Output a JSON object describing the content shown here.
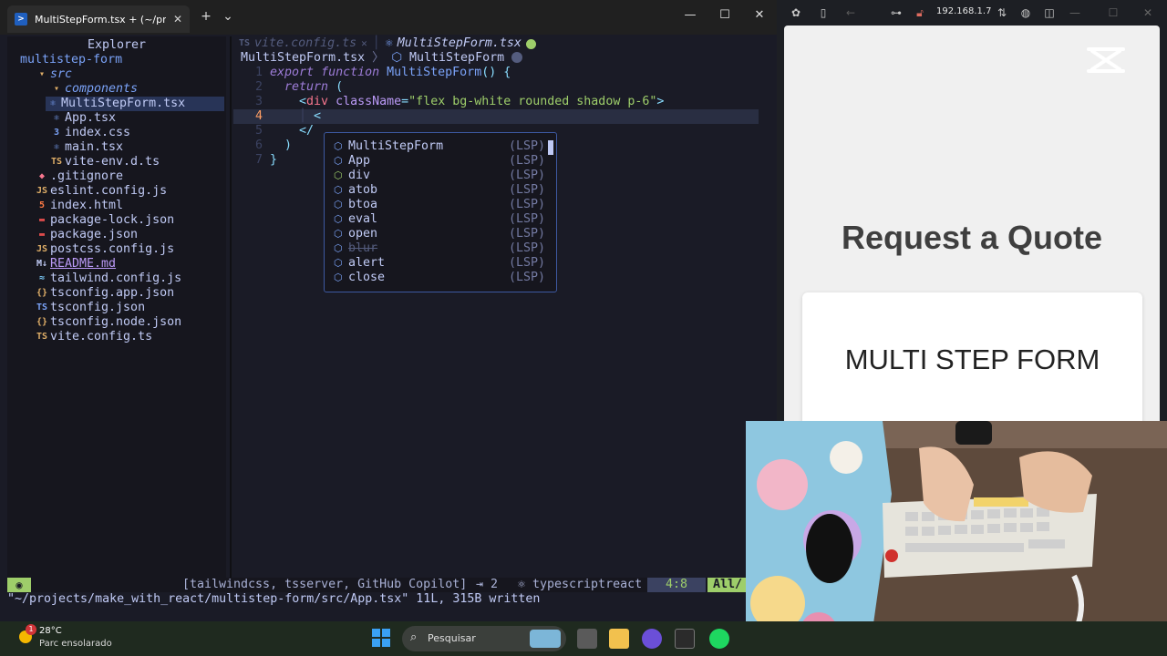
{
  "terminal": {
    "tab_title": "MultiStepForm.tsx + (~/proje",
    "tab_close": "✕",
    "new_tab": "+",
    "dropdown": "⌄",
    "minimize": "—",
    "maximize": "☐",
    "close": "✕"
  },
  "explorer": {
    "title": "Explorer",
    "root": "multistep-form",
    "items": [
      {
        "label": "src",
        "indent": 1,
        "icon": "folder-open-icon",
        "glyph": "▾",
        "color": "#7aa2f7"
      },
      {
        "label": "components",
        "indent": 2,
        "icon": "folder-open-icon",
        "glyph": "▾",
        "color": "#7aa2f7"
      },
      {
        "label": "MultiStepForm.tsx",
        "indent": 3,
        "icon": "react-icon",
        "glyph": "⚛",
        "color": "#c0caf5"
      },
      {
        "label": "App.tsx",
        "indent": 2,
        "icon": "react-icon",
        "glyph": "⚛",
        "color": "#c0caf5"
      },
      {
        "label": "index.css",
        "indent": 2,
        "icon": "css-icon",
        "glyph": "3",
        "color": "#c0caf5"
      },
      {
        "label": "main.tsx",
        "indent": 2,
        "icon": "react-icon",
        "glyph": "⚛",
        "color": "#c0caf5"
      },
      {
        "label": "vite-env.d.ts",
        "indent": 2,
        "icon": "typescript-icon",
        "glyph": "TS",
        "color": "#c0caf5"
      },
      {
        "label": ".gitignore",
        "indent": 1,
        "icon": "git-icon",
        "glyph": "◆",
        "color": "#c0caf5"
      },
      {
        "label": "eslint.config.js",
        "indent": 1,
        "icon": "javascript-icon",
        "glyph": "JS",
        "color": "#c0caf5"
      },
      {
        "label": "index.html",
        "indent": 1,
        "icon": "html-icon",
        "glyph": "5",
        "color": "#c0caf5"
      },
      {
        "label": "package-lock.json",
        "indent": 1,
        "icon": "npm-icon",
        "glyph": "▬",
        "color": "#c0caf5"
      },
      {
        "label": "package.json",
        "indent": 1,
        "icon": "npm-icon",
        "glyph": "▬",
        "color": "#c0caf5"
      },
      {
        "label": "postcss.config.js",
        "indent": 1,
        "icon": "javascript-icon",
        "glyph": "JS",
        "color": "#c0caf5"
      },
      {
        "label": "README.md",
        "indent": 1,
        "icon": "markdown-icon",
        "glyph": "M↓",
        "color": "#bb9af7"
      },
      {
        "label": "tailwind.config.js",
        "indent": 1,
        "icon": "tailwind-icon",
        "glyph": "≈",
        "color": "#c0caf5"
      },
      {
        "label": "tsconfig.app.json",
        "indent": 1,
        "icon": "json-icon",
        "glyph": "{}",
        "color": "#c0caf5"
      },
      {
        "label": "tsconfig.json",
        "indent": 1,
        "icon": "typescript-config-icon",
        "glyph": "TS",
        "color": "#c0caf5"
      },
      {
        "label": "tsconfig.node.json",
        "indent": 1,
        "icon": "json-icon",
        "glyph": "{}",
        "color": "#c0caf5"
      },
      {
        "label": "vite.config.ts",
        "indent": 1,
        "icon": "typescript-icon",
        "glyph": "TS",
        "color": "#c0caf5"
      }
    ]
  },
  "editor": {
    "tab_inactive_icon": "TS",
    "tab_inactive": "vite.config.ts",
    "tab_inactive_close": "✕",
    "tab_active_icon": "⚛",
    "tab_active": "MultiStepForm.tsx",
    "winbar_file": "MultiStepForm.tsx",
    "winbar_sep": "〉",
    "winbar_symbol": "MultiStepForm",
    "lines": [
      {
        "n": "1",
        "tokens": [
          [
            "kw",
            "export"
          ],
          [
            "",
            " "
          ],
          [
            "kw",
            "function"
          ],
          [
            "",
            " "
          ],
          [
            "fn",
            "MultiStepForm"
          ],
          [
            "pn",
            "() {"
          ]
        ]
      },
      {
        "n": "2",
        "tokens": [
          [
            "guide",
            "  "
          ],
          [
            "kw",
            "return"
          ],
          [
            "",
            " "
          ],
          [
            "pn",
            "("
          ]
        ]
      },
      {
        "n": "3",
        "tokens": [
          [
            "guide",
            "    "
          ],
          [
            "pn",
            "<"
          ],
          [
            "tag",
            "div"
          ],
          [
            "",
            " "
          ],
          [
            "attr",
            "className"
          ],
          [
            "pn",
            "="
          ],
          [
            "str",
            "\"flex bg-white rounded shadow p-6\""
          ],
          [
            "pn",
            ">"
          ]
        ]
      },
      {
        "n": "4",
        "tokens": [
          [
            "guide",
            "    │ "
          ],
          [
            "pn",
            "<"
          ]
        ],
        "current": true
      },
      {
        "n": "5",
        "tokens": [
          [
            "guide",
            "    "
          ],
          [
            "pn",
            "</"
          ]
        ]
      },
      {
        "n": "6",
        "tokens": [
          [
            "guide",
            "  "
          ],
          [
            "pn",
            ")"
          ]
        ]
      },
      {
        "n": "7",
        "tokens": [
          [
            "pn",
            "}"
          ]
        ]
      }
    ]
  },
  "completion": {
    "items": [
      {
        "label": "MultiStepForm",
        "source": "(LSP)",
        "icon": "⬡",
        "deprecated": false
      },
      {
        "label": "App",
        "source": "(LSP)",
        "icon": "⬡",
        "deprecated": false
      },
      {
        "label": "div",
        "source": "(LSP)",
        "icon": "⬡",
        "deprecated": false,
        "tag": true
      },
      {
        "label": "atob",
        "source": "(LSP)",
        "icon": "⬡",
        "deprecated": false
      },
      {
        "label": "btoa",
        "source": "(LSP)",
        "icon": "⬡",
        "deprecated": false
      },
      {
        "label": "eval",
        "source": "(LSP)",
        "icon": "⬡",
        "deprecated": false
      },
      {
        "label": "open",
        "source": "(LSP)",
        "icon": "⬡",
        "deprecated": false
      },
      {
        "label": "blur",
        "source": "(LSP)",
        "icon": "⬡",
        "deprecated": true
      },
      {
        "label": "alert",
        "source": "(LSP)",
        "icon": "⬡",
        "deprecated": false
      },
      {
        "label": "close",
        "source": "(LSP)",
        "icon": "⬡",
        "deprecated": false
      }
    ]
  },
  "statusline": {
    "mode_icon": "◉",
    "lsp": "[tailwindcss, tsserver, GitHub Copilot]",
    "tabs": "⇥ 2",
    "filetype": "⚛ typescriptreact",
    "position": "4:8",
    "percent": "All/",
    "message": "\"~/projects/make_with_react/multistep-form/src/App.tsx\" 11L, 315B written"
  },
  "browser": {
    "url": "192.168.1.7",
    "page_title": "Request a Quote",
    "form_heading": "MULTI STEP FORM"
  },
  "taskbar": {
    "badge": "1",
    "temperature": "28°C",
    "condition": "Parc ensolarado",
    "search_label": "Pesquisar"
  },
  "colors": {
    "editor_bg": "#1a1b26",
    "accent_green": "#9ece6a",
    "accent_blue": "#7aa2f7",
    "taskbar_bg": "#1f2a1f"
  }
}
